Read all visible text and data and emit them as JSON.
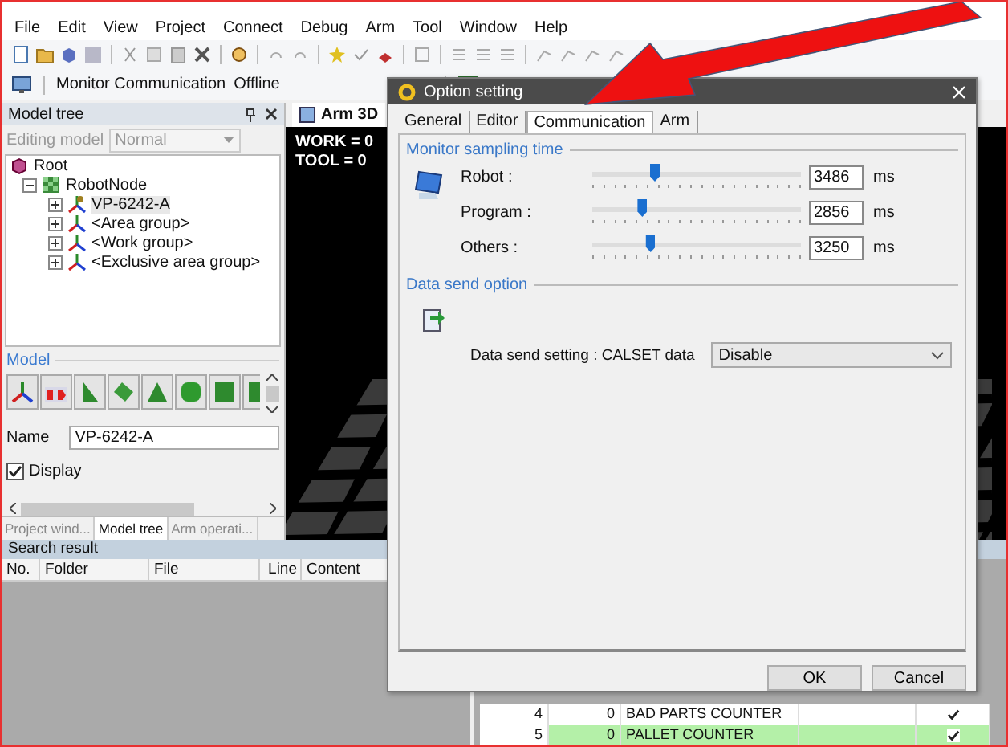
{
  "menu": [
    "File",
    "Edit",
    "View",
    "Project",
    "Connect",
    "Debug",
    "Arm",
    "Tool",
    "Window",
    "Help"
  ],
  "monitor_toolbar": {
    "label": "Monitor Communication",
    "status": "Offline"
  },
  "model_tree_panel": {
    "title": "Model tree",
    "editing_label": "Editing model",
    "editing_value": "Normal",
    "editing_disabled": true,
    "tree": [
      {
        "label": "Root",
        "kind": "root",
        "children": [
          {
            "label": "RobotNode",
            "kind": "node",
            "expanded": true,
            "children": [
              {
                "label": "VP-6242-A",
                "kind": "robot",
                "expanded": false,
                "selected": true
              },
              {
                "label": "<Area group>",
                "kind": "axes",
                "expanded": false,
                "selected": false
              },
              {
                "label": "<Work group>",
                "kind": "axes",
                "expanded": false,
                "selected": false
              },
              {
                "label": "<Exclusive area group>",
                "kind": "axes",
                "expanded": false,
                "selected": false
              }
            ]
          }
        ]
      }
    ],
    "model_section": {
      "title": "Model",
      "name_label": "Name",
      "name_value": "VP-6242-A",
      "display_label": "Display",
      "display_checked": true
    },
    "tabs": [
      {
        "label": "Project wind...",
        "selected": false
      },
      {
        "label": "Model tree",
        "selected": true
      },
      {
        "label": "Arm operati...",
        "selected": false
      }
    ]
  },
  "view": {
    "tab": "Arm 3D",
    "lines": [
      "WORK = 0",
      "TOOL = 0"
    ]
  },
  "search_result": {
    "title": "Search result",
    "columns": [
      "No.",
      "Folder",
      "File",
      "Line",
      "Content"
    ]
  },
  "variable_table": {
    "rows": [
      {
        "cells": [
          "4",
          "0",
          "BAD PARTS COUNTER",
          ""
        ],
        "checked": true,
        "highlighted": false
      },
      {
        "cells": [
          "5",
          "0",
          "PALLET COUNTER",
          ""
        ],
        "checked": true,
        "highlighted": true
      }
    ]
  },
  "dialog": {
    "title": "Option setting",
    "tabs": [
      {
        "label": "General",
        "selected": false
      },
      {
        "label": "Editor",
        "selected": false
      },
      {
        "label": "Communication",
        "selected": true
      },
      {
        "label": "Arm",
        "selected": false
      }
    ],
    "sampling": {
      "title": "Monitor sampling time",
      "rows": [
        {
          "label": "Robot :",
          "level": 0.3,
          "value": "3486",
          "unit": "ms"
        },
        {
          "label": "Program :",
          "level": 0.24,
          "value": "2856",
          "unit": "ms"
        },
        {
          "label": "Others :",
          "level": 0.28,
          "value": "3250",
          "unit": "ms"
        }
      ]
    },
    "data_send": {
      "title": "Data send option",
      "label": "Data send setting : CALSET data",
      "value": "Disable"
    },
    "buttons": [
      "OK",
      "Cancel"
    ]
  }
}
